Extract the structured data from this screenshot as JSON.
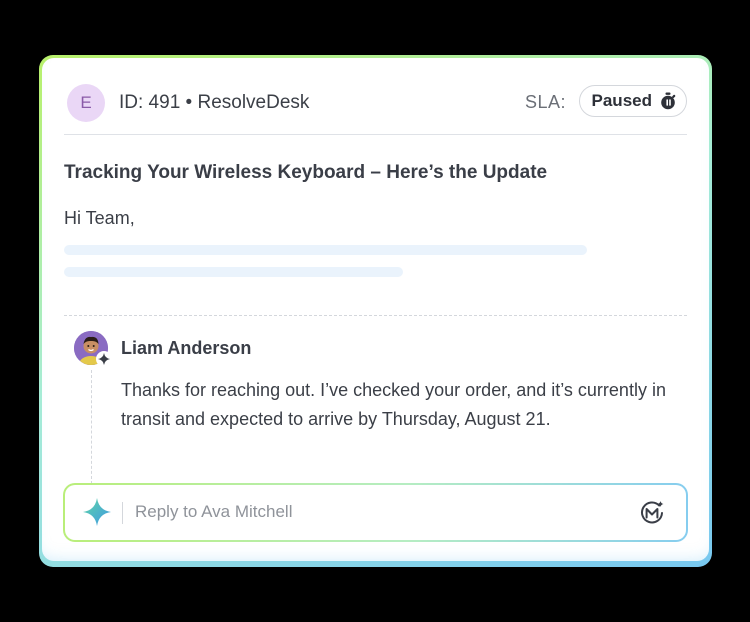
{
  "header": {
    "avatar_letter": "E",
    "ticket_id": "ID: 491 • ResolveDesk",
    "sla_label": "SLA:",
    "sla_status": "Paused"
  },
  "email": {
    "subject": "Tracking Your Wireless Keyboard – Here’s the Update",
    "greeting": "Hi Team,"
  },
  "reply_message": {
    "author": "Liam Anderson",
    "body": "Thanks for reaching out. I’ve checked your order, and it’s currently in transit and expected to arrive by Thursday, August 21."
  },
  "composer": {
    "placeholder": "Reply to Ava Mitchell",
    "left_icon": "sparkle-icon",
    "right_icon": "ai-assist-icon"
  },
  "colors": {
    "accent_green": "#b9ee79",
    "accent_blue": "#86cdef",
    "avatar_bg": "#ead7f6"
  }
}
